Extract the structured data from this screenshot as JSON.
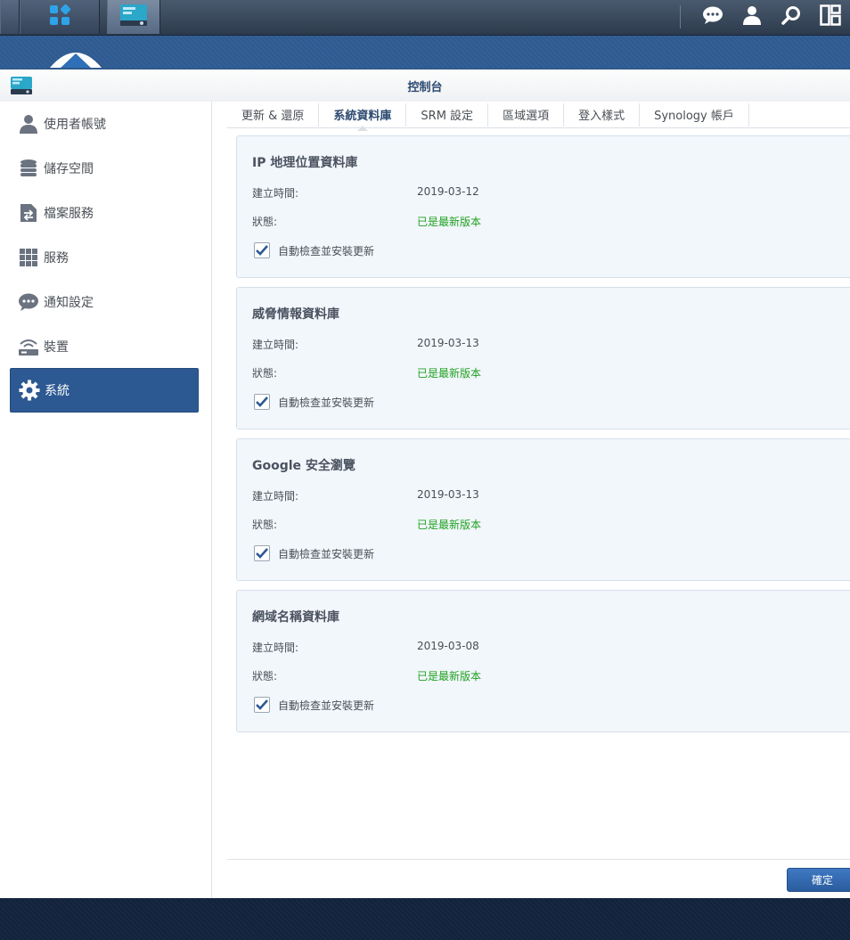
{
  "window": {
    "title": "控制台"
  },
  "sidebar": {
    "items": [
      {
        "label": "使用者帳號",
        "icon": "user-icon"
      },
      {
        "label": "儲存空間",
        "icon": "database-icon"
      },
      {
        "label": "檔案服務",
        "icon": "file-transfer-icon"
      },
      {
        "label": "服務",
        "icon": "grid-icon"
      },
      {
        "label": "通知設定",
        "icon": "chat-icon"
      },
      {
        "label": "裝置",
        "icon": "router-icon"
      },
      {
        "label": "系統",
        "icon": "gear-icon"
      }
    ]
  },
  "tabs": [
    {
      "label": "更新 & 還原"
    },
    {
      "label": "系統資料庫"
    },
    {
      "label": "SRM 設定"
    },
    {
      "label": "區域選項"
    },
    {
      "label": "登入樣式"
    },
    {
      "label": "Synology 帳戶"
    }
  ],
  "labels": {
    "created": "建立時間:",
    "status": "狀態:",
    "auto_update": "自動檢查並安裝更新"
  },
  "cards": [
    {
      "title": "IP 地理位置資料庫",
      "date": "2019-03-12",
      "status": "已是最新版本",
      "checked": true
    },
    {
      "title": "威脅情報資料庫",
      "date": "2019-03-13",
      "status": "已是最新版本",
      "checked": true
    },
    {
      "title": "Google 安全瀏覽",
      "date": "2019-03-13",
      "status": "已是最新版本",
      "checked": true
    },
    {
      "title": "網域名稱資料庫",
      "date": "2019-03-08",
      "status": "已是最新版本",
      "checked": true
    }
  ],
  "footer": {
    "ok_label": "確定"
  },
  "colors": {
    "accent": "#2d5992",
    "status_ok": "#21a121",
    "card_bg": "#f2f7fc"
  }
}
